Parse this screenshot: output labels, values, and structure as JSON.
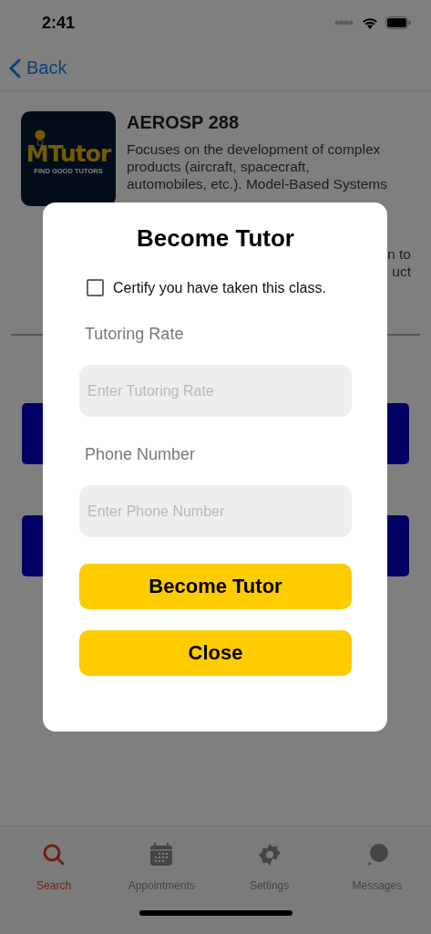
{
  "status_bar": {
    "time": "2:41"
  },
  "nav": {
    "back": "Back"
  },
  "course": {
    "logo": {
      "name": "MTutor",
      "tagline": "FIND GOOD TUTORS"
    },
    "title": "AEROSP 288",
    "description_lines": [
      "Focuses on the development of complex",
      "products (aircraft, spacecraft,",
      "automobiles, etc.). Model-Based Systems"
    ],
    "description_fragments": [
      "n to",
      "uct"
    ]
  },
  "modal": {
    "title": "Become Tutor",
    "certify": {
      "label": "Certify you have taken this class.",
      "checked": false
    },
    "fields": [
      {
        "label": "Tutoring Rate",
        "placeholder": "Enter Tutoring Rate"
      },
      {
        "label": "Phone Number",
        "placeholder": "Enter Phone Number"
      }
    ],
    "buttons": [
      "Become Tutor",
      "Close"
    ]
  },
  "tabs": [
    {
      "kind": "search",
      "label": "Search",
      "selected": true
    },
    {
      "kind": "calendar",
      "label": "Appointments",
      "selected": false
    },
    {
      "kind": "settings",
      "label": "Settings",
      "selected": false
    },
    {
      "kind": "messages",
      "label": "Messages",
      "selected": false
    }
  ]
}
